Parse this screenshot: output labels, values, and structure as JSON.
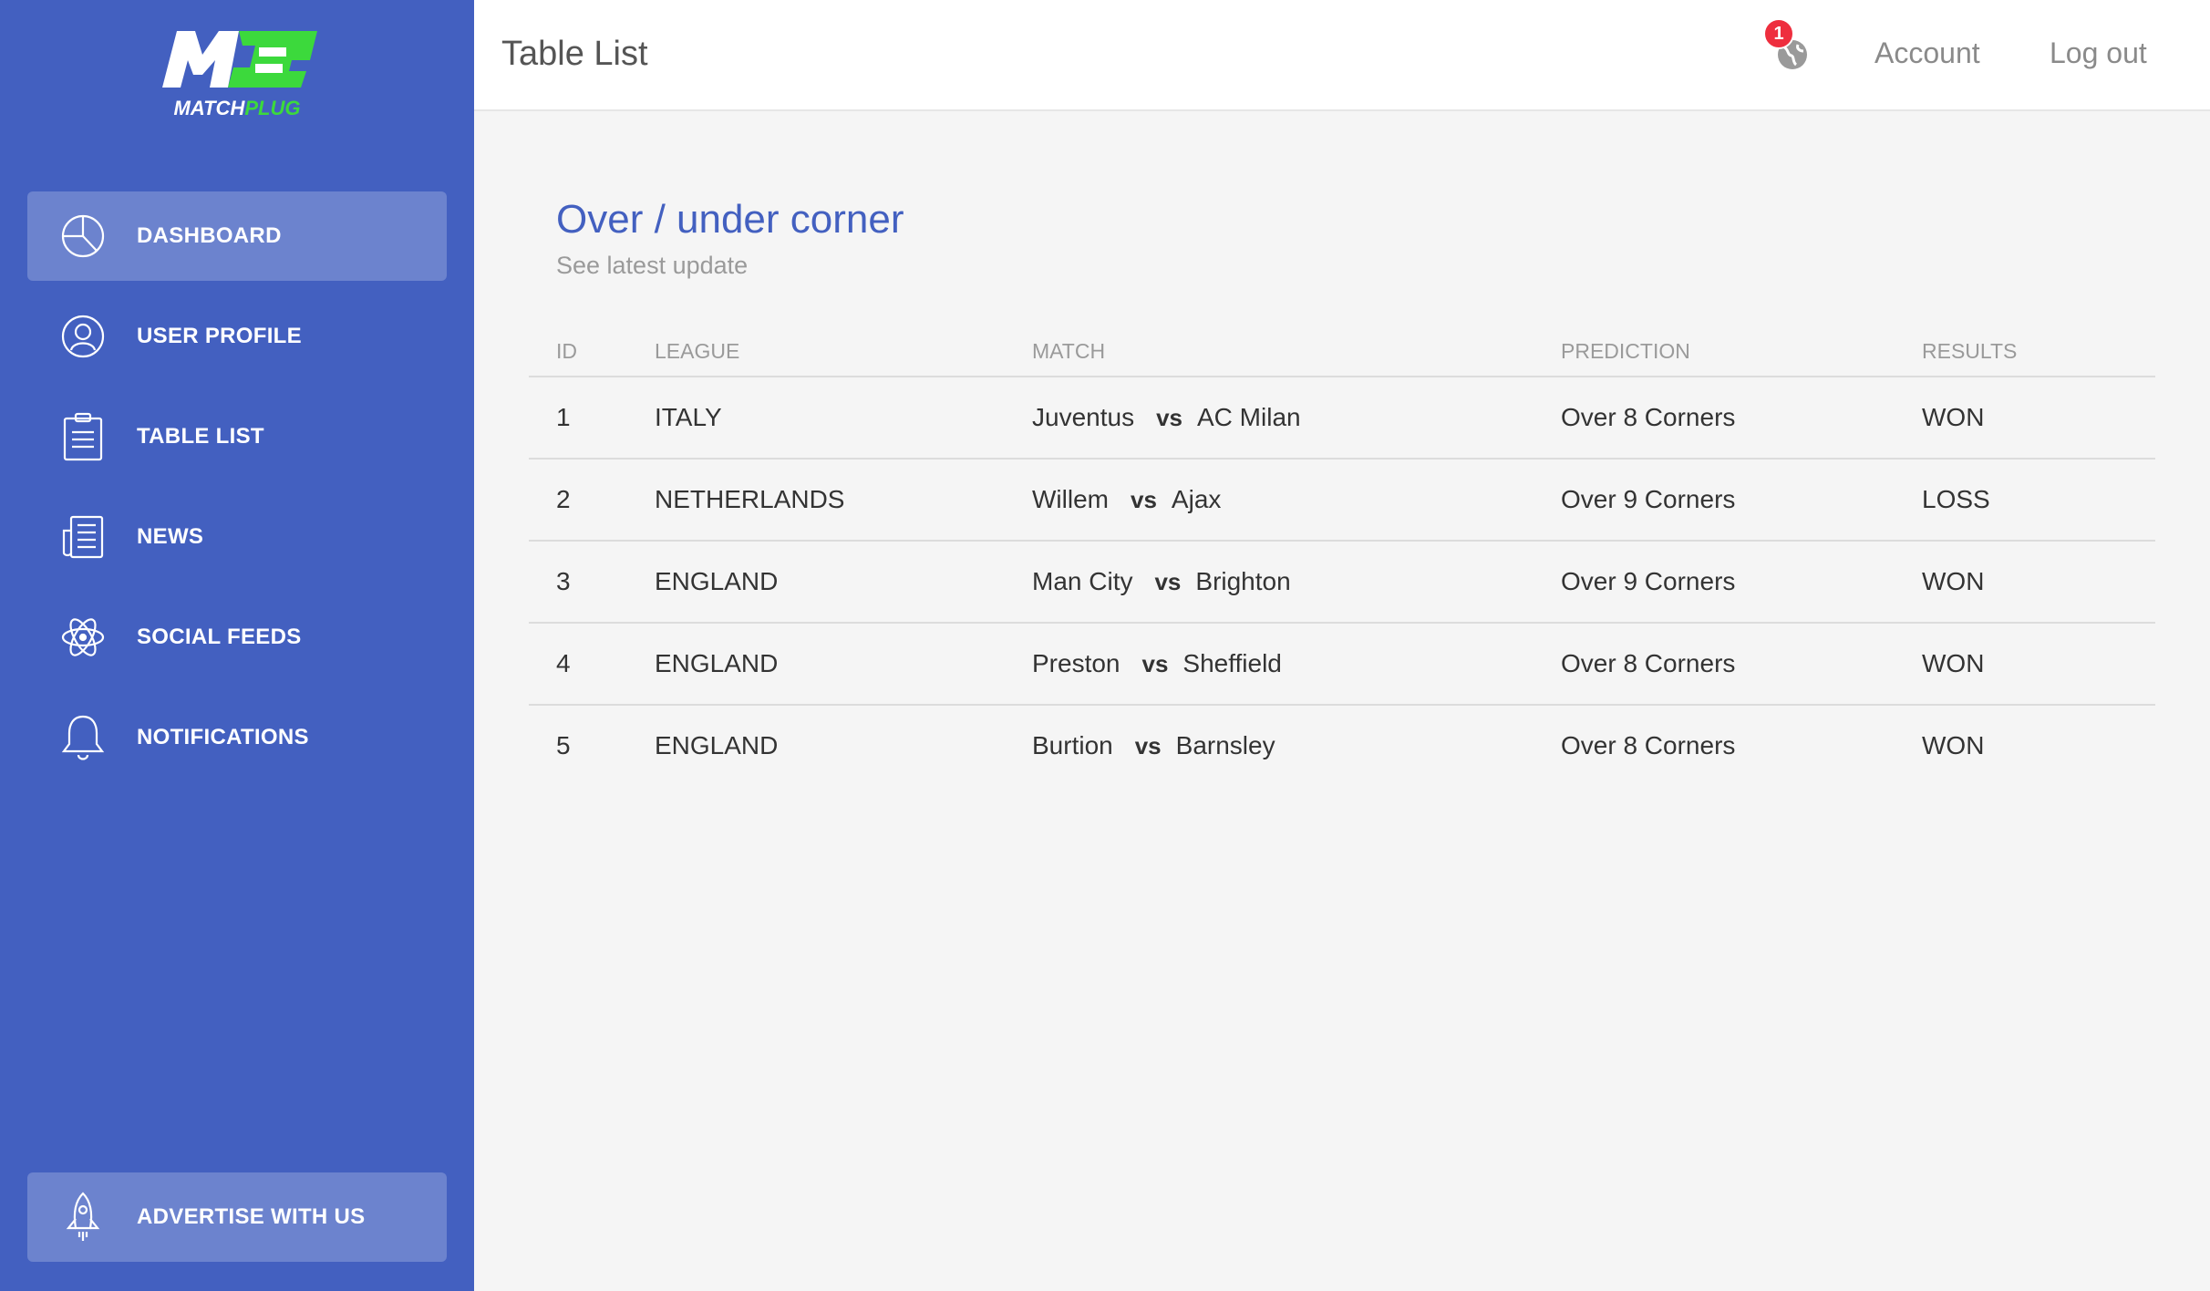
{
  "brand": {
    "logo_letters": "MC",
    "logo_text_a": "MATCH",
    "logo_text_b": "PLUG",
    "accent": "#3cd93c",
    "sidebar_color": "#4360c0"
  },
  "sidebar": {
    "items": [
      {
        "label": "DASHBOARD",
        "icon": "pie-chart-icon",
        "active": true
      },
      {
        "label": "USER PROFILE",
        "icon": "user-icon"
      },
      {
        "label": "TABLE LIST",
        "icon": "clipboard-icon"
      },
      {
        "label": "NEWS",
        "icon": "newspaper-icon"
      },
      {
        "label": "SOCIAL FEEDS",
        "icon": "atom-icon"
      },
      {
        "label": "NOTIFICATIONS",
        "icon": "bell-icon"
      }
    ],
    "bottom": {
      "label": "ADVERTISE WITH US",
      "icon": "rocket-icon"
    }
  },
  "header": {
    "title": "Table List",
    "notification_count": "1",
    "account": "Account",
    "logout": "Log out"
  },
  "main": {
    "title": "Over / under corner",
    "subtitle": "See latest update",
    "columns": [
      "ID",
      "LEAGUE",
      "MATCH",
      "PREDICTION",
      "RESULTS"
    ],
    "vs_label": "vs",
    "rows": [
      {
        "id": "1",
        "league": "ITALY",
        "home": "Juventus",
        "away": "AC Milan",
        "prediction": "Over 8 Corners",
        "result": "WON"
      },
      {
        "id": "2",
        "league": "NETHERLANDS",
        "home": "Willem",
        "away": "Ajax",
        "prediction": "Over 9 Corners",
        "result": "LOSS"
      },
      {
        "id": "3",
        "league": "ENGLAND",
        "home": "Man City",
        "away": "Brighton",
        "prediction": "Over 9 Corners",
        "result": "WON"
      },
      {
        "id": "4",
        "league": "ENGLAND",
        "home": "Preston",
        "away": "Sheffield",
        "prediction": "Over 8 Corners",
        "result": "WON"
      },
      {
        "id": "5",
        "league": "ENGLAND",
        "home": "Burtion",
        "away": "Barnsley",
        "prediction": "Over 8 Corners",
        "result": "WON"
      }
    ]
  }
}
